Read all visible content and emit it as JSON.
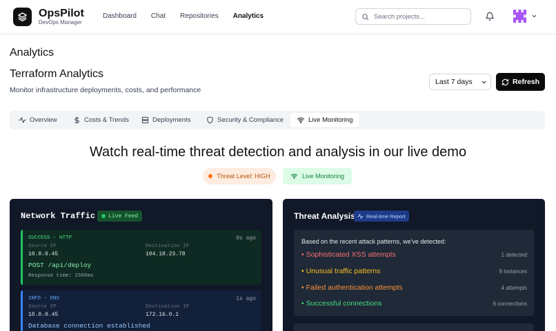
{
  "brand": {
    "name": "OpsPilot",
    "subtitle": "DevOps Manager"
  },
  "nav": [
    {
      "label": "Dashboard"
    },
    {
      "label": "Chat"
    },
    {
      "label": "Repositories"
    },
    {
      "label": "Analytics",
      "active": true
    }
  ],
  "search": {
    "placeholder": "Search projects...",
    "value": ""
  },
  "header": {
    "page_title": "Analytics",
    "section_title": "Terraform Analytics",
    "section_subtitle": "Monitor infrastructure deployments, costs, and performance",
    "range_selected": "Last 7 days",
    "refresh_label": "Refresh"
  },
  "tabs": [
    {
      "label": "Overview",
      "icon": "activity-icon"
    },
    {
      "label": "Costs & Trends",
      "icon": "dollar-icon"
    },
    {
      "label": "Deployments",
      "icon": "server-icon"
    },
    {
      "label": "Security & Compliance",
      "icon": "shield-icon"
    },
    {
      "label": "Live Monitoring",
      "icon": "wifi-icon",
      "active": true
    }
  ],
  "hero": {
    "title": "Watch real-time threat detection and analysis in our live demo",
    "threat_badge": "Threat Level: HIGH",
    "live_badge": "Live Monitoring"
  },
  "network": {
    "title": "Network Traffic",
    "badge": "Live Feed",
    "source_label": "Source IP",
    "dest_label": "Destination IP",
    "entries": [
      {
        "type": "SUCCESS - HTTP",
        "time": "0s ago",
        "source": "10.0.0.45",
        "dest": "104.18.23.78",
        "message": "POST /api/deploy",
        "response": "Response time: 1506ms"
      },
      {
        "type": "INFO - DNS",
        "time": "1s ago",
        "source": "10.0.0.45",
        "dest": "172.16.0.1",
        "message": "Database connection established"
      }
    ]
  },
  "threat": {
    "title": "Threat Analysis",
    "badge": "Real-time Report",
    "intro": "Based on the recent attack patterns, we've detected:",
    "items": [
      {
        "label": "• Sophisticated XSS attempts",
        "count": "1 detected",
        "color": "#f87171"
      },
      {
        "label": "• Unusual traffic patterns",
        "count": "9 instances",
        "color": "#fbbf24"
      },
      {
        "label": "• Failed authentication attempts",
        "count": "4 attempts",
        "color": "#fb923c"
      },
      {
        "label": "• Successful connections",
        "count": "6 connections",
        "color": "#4ade80"
      }
    ]
  },
  "colors": {
    "success": "#22c55e",
    "info": "#60a5fa",
    "dark_panel": "#111827"
  }
}
